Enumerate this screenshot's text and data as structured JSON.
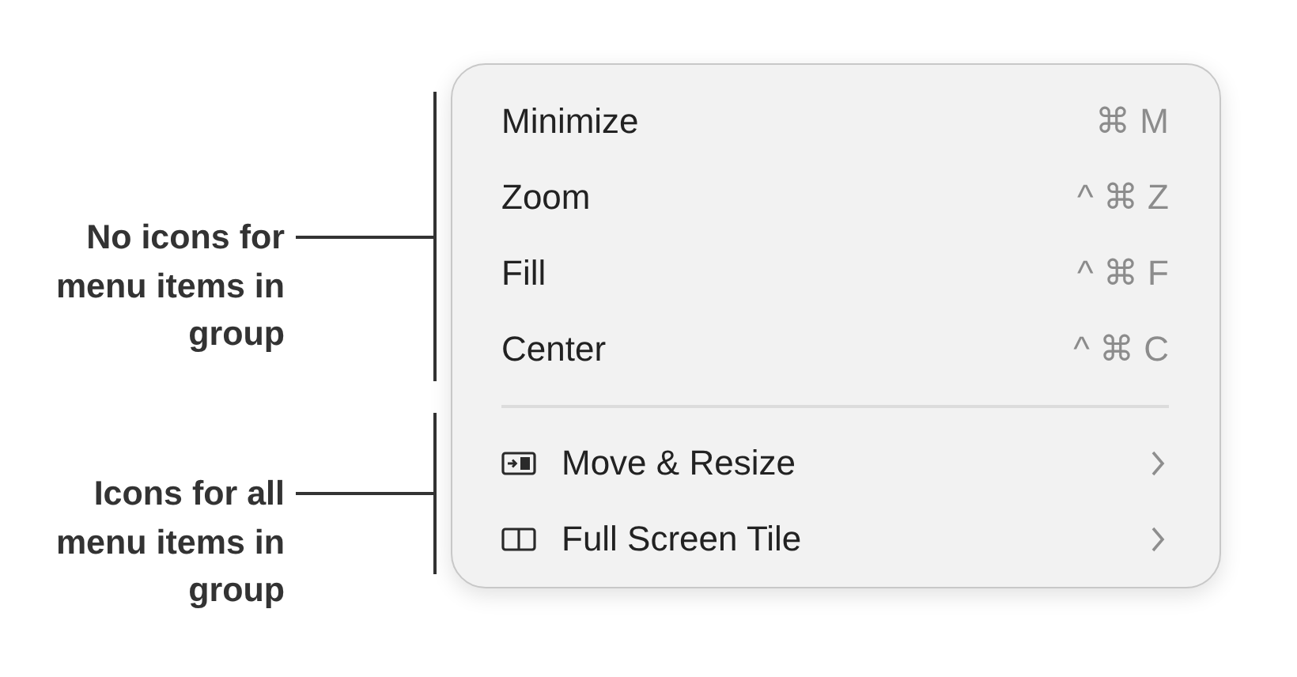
{
  "annotations": [
    {
      "text": "No icons for menu items in group"
    },
    {
      "text": "Icons for all menu items in group"
    }
  ],
  "menu": {
    "groups": [
      {
        "items": [
          {
            "kind": "plain",
            "label": "Minimize",
            "shortcut": "⌘ M"
          },
          {
            "kind": "plain",
            "label": "Zoom",
            "shortcut": "^ ⌘ Z"
          },
          {
            "kind": "plain",
            "label": "Fill",
            "shortcut": "^ ⌘ F"
          },
          {
            "kind": "plain",
            "label": "Center",
            "shortcut": "^ ⌘ C"
          }
        ]
      },
      {
        "items": [
          {
            "kind": "submenu",
            "label": "Move & Resize"
          },
          {
            "kind": "submenu",
            "label": "Full Screen Tile"
          }
        ]
      }
    ]
  }
}
